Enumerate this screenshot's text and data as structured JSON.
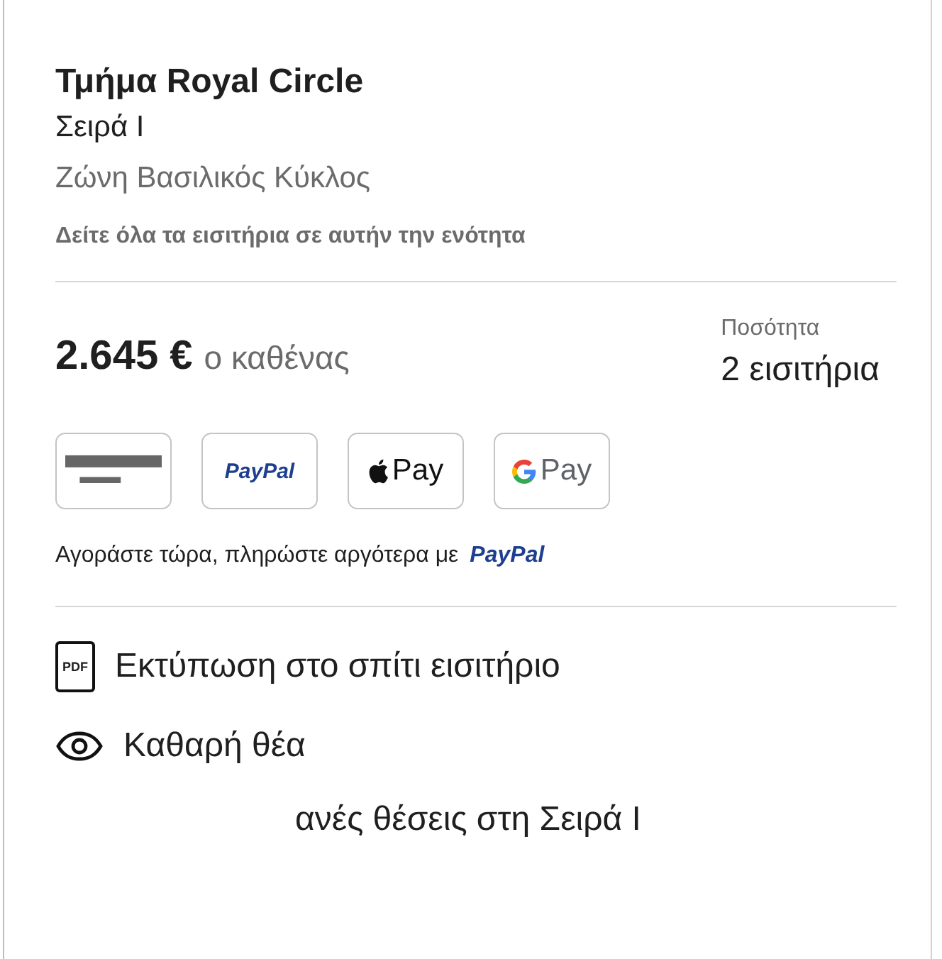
{
  "section": {
    "title": "Τμήμα Royal Circle",
    "row": "Σειρά I",
    "zone": "Ζώνη Βασιλικός Κύκλος",
    "link": "Δείτε όλα τα εισιτήρια σε αυτήν την ενότητα"
  },
  "price": {
    "amount": "2.645 €",
    "unit": "ο καθένας",
    "quantity_label": "Ποσότητα",
    "quantity": "2 εισιτήρια"
  },
  "payment_methods": [
    {
      "kind": "card"
    },
    {
      "kind": "paypal",
      "label": "PayPal"
    },
    {
      "kind": "applepay",
      "label": "Pay"
    },
    {
      "kind": "googlepay",
      "label": "Pay"
    }
  ],
  "pay_later": {
    "text": "Αγοράστε τώρα, πληρώστε αργότερα με",
    "brand": "PayPal"
  },
  "features": [
    {
      "kind": "pdf",
      "icon_text": "PDF",
      "label": "Εκτύπωση στο σπίτι εισιτήριο"
    },
    {
      "kind": "eye",
      "label": "Καθαρή θέα"
    },
    {
      "kind": "none",
      "label": "ανές θέσεις στη Σειρά I"
    }
  ]
}
